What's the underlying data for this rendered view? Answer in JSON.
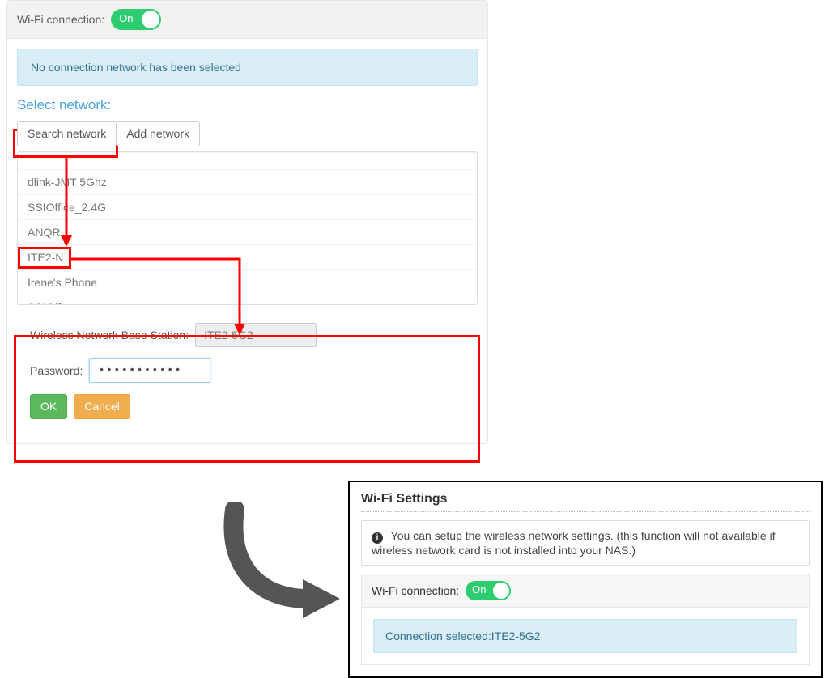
{
  "panel1": {
    "wifi_label": "Wi-Fi connection:",
    "toggle_label": "On",
    "alert": "No connection network has been selected",
    "select_title": "Select network:",
    "search_btn": "Search network",
    "add_btn": "Add network",
    "networks": [
      "dlink-JMT 5Ghz",
      "SSIOffice_2.4G",
      "ANQR",
      "ITE2-N",
      "Irene's Phone",
      "SSIOffice"
    ],
    "form": {
      "base_label": "Wireless Network Base Station:",
      "base_value": "ITE2-5G2",
      "pwd_label": "Password:",
      "pwd_value": "•••••••••••",
      "ok": "OK",
      "cancel": "Cancel"
    }
  },
  "panel2": {
    "title": "Wi-Fi Settings",
    "info": "You can setup the wireless network settings. (this function will not available if wireless network card is not installed into your NAS.)",
    "wifi_label": "Wi-Fi connection:",
    "toggle_label": "On",
    "alert": "Connection selected:ITE2-5G2"
  }
}
